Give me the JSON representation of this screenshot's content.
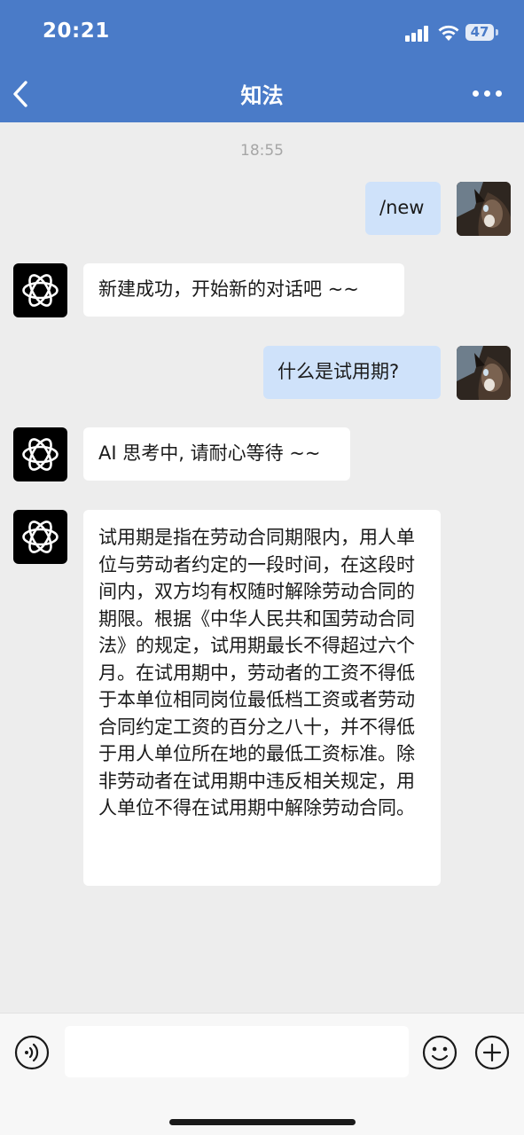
{
  "status_bar": {
    "time": "20:21",
    "battery": "47"
  },
  "nav": {
    "title": "知法"
  },
  "chat": {
    "timestamp": "18:55",
    "messages": [
      {
        "sender": "user",
        "text": "/new"
      },
      {
        "sender": "bot",
        "text": "新建成功，开始新的对话吧 ~~"
      },
      {
        "sender": "user",
        "text": "什么是试用期?"
      },
      {
        "sender": "bot",
        "text": "AI 思考中, 请耐心等待 ~~"
      },
      {
        "sender": "bot",
        "text": "试用期是指在劳动合同期限内，用人单位与劳动者约定的一段时间，在这段时间内，双方均有权随时解除劳动合同的期限。根据《中华人民共和国劳动合同法》的规定，试用期最长不得超过六个月。在试用期中，劳动者的工资不得低于本单位相同岗位最低档工资或者劳动合同约定工资的百分之八十，并不得低于用人单位所在地的最低工资标准。除非劳动者在试用期中违反相关规定，用人单位不得在试用期中解除劳动合同。"
      }
    ]
  },
  "input": {
    "value": "",
    "placeholder": ""
  },
  "colors": {
    "header": "#4A7BC8",
    "user_bubble": "#CFE2FA",
    "bot_bubble": "#FFFFFF",
    "background": "#EDEDED"
  },
  "icons": {
    "back": "chevron-left-icon",
    "more": "more-dots-icon",
    "voice": "voice-icon",
    "emoji": "emoji-icon",
    "plus": "plus-icon",
    "bot_avatar": "openai-logo-icon"
  }
}
